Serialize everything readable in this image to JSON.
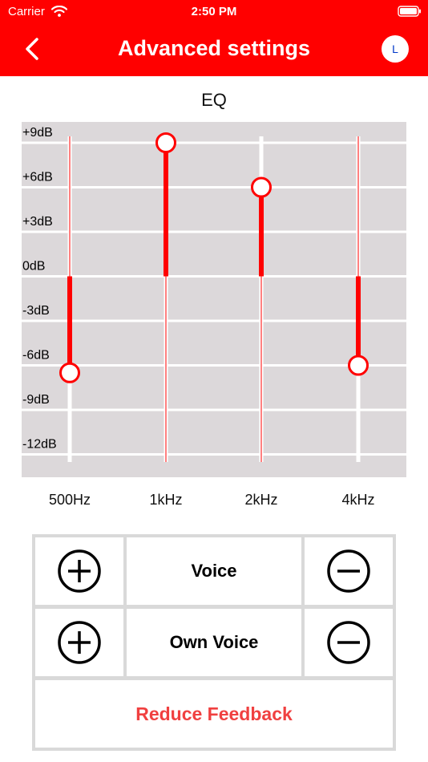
{
  "status": {
    "carrier": "Carrier",
    "time": "2:50 PM"
  },
  "header": {
    "title": "Advanced settings",
    "side_badge": "L"
  },
  "eq": {
    "title": "EQ",
    "db_labels": [
      "+9dB",
      "+6dB",
      "+3dB",
      "0dB",
      "-3dB",
      "-6dB",
      "-9dB",
      "-12dB"
    ],
    "bands": [
      {
        "label": "500Hz",
        "gain_db": -6.5
      },
      {
        "label": "1kHz",
        "gain_db": 9
      },
      {
        "label": "2kHz",
        "gain_db": 6
      },
      {
        "label": "4kHz",
        "gain_db": -6
      }
    ],
    "accent": "#ff0000",
    "plot_background": "#dcd8da"
  },
  "controls": {
    "voice_label": "Voice",
    "own_voice_label": "Own Voice",
    "reduce_feedback_label": "Reduce Feedback",
    "reduce_color": "#f04040"
  }
}
